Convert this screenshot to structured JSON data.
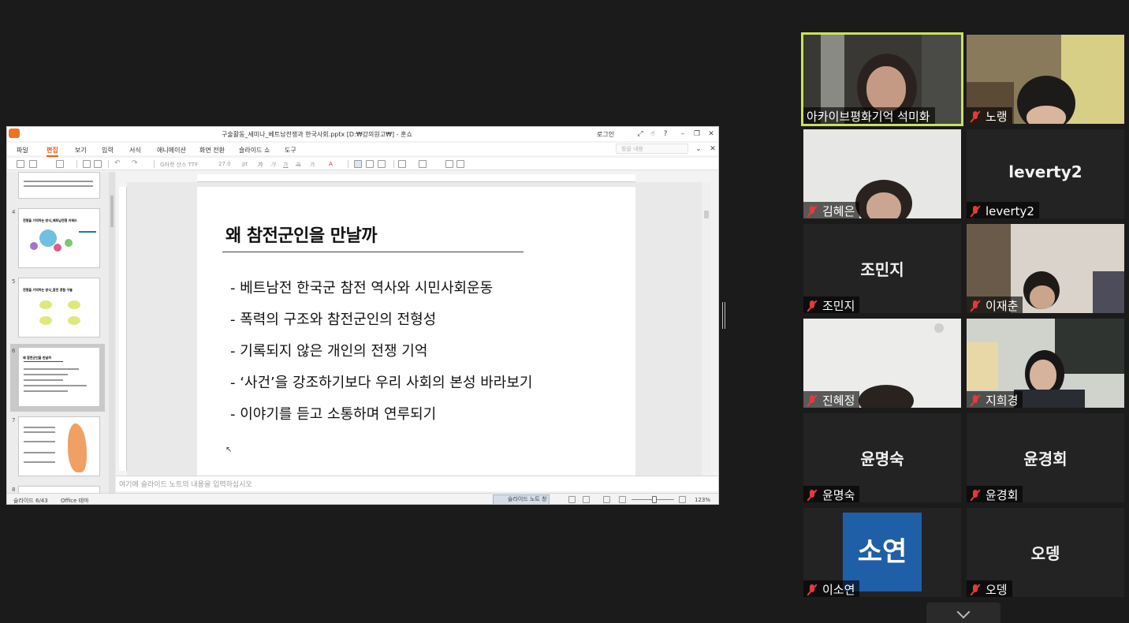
{
  "app": {
    "title": "구술활동_세미나_베트남전쟁과 한국사회.pptx [D:₩강의원고₩] - 훈쇼",
    "login_label": "로그인",
    "menus": [
      "파일",
      "편집",
      "보기",
      "입력",
      "서식",
      "애니메이션",
      "화면 전환",
      "슬라이드 쇼",
      "도구"
    ],
    "find_placeholder": "찾을 내용",
    "font_name": "G마켓 산스 TTF",
    "font_size": "27.0",
    "font_unit": "pt",
    "notes_placeholder": "여기에 슬라이드 노트의 내용을 입력하십시오",
    "status": {
      "slide_count": "슬라이드 6/43",
      "theme": "Office 테마",
      "notes_button": "슬라이드 노트 창",
      "zoom": "123%"
    }
  },
  "thumbnails": [
    {
      "num": "4",
      "title": "전쟁을 기억하는 방식_베트남전쟁 키워드"
    },
    {
      "num": "5",
      "title": "전쟁을 기억하는 방식_참전 경험 구술"
    },
    {
      "num": "6",
      "title": "왜 참전군인을 만날까"
    },
    {
      "num": "7",
      "title": ""
    },
    {
      "num": "8",
      "title": ""
    }
  ],
  "slide": {
    "title": "왜 참전군인을 만날까",
    "bullets": [
      "- 베트남전 한국군 참전 역사와 시민사회운동",
      "- 폭력의 구조와 참전군인의 전형성",
      "- 기록되지 않은 개인의 전쟁 기억",
      "- ‘사건’을 강조하기보다 우리 사회의 본성 바라보기",
      "- 이야기를 듣고 소통하며 연루되기"
    ]
  },
  "participants": [
    {
      "name": "아카이브평화기억 석미화",
      "muted": false,
      "video": true,
      "active": true
    },
    {
      "name": "노랭",
      "muted": true,
      "video": true
    },
    {
      "name": "김혜은",
      "muted": true,
      "video": true
    },
    {
      "name": "leverty2",
      "display": "leverty2",
      "muted": true,
      "video": false
    },
    {
      "name": "조민지",
      "display": "조민지",
      "muted": true,
      "video": false
    },
    {
      "name": "이재춘",
      "muted": true,
      "video": true
    },
    {
      "name": "진혜정",
      "muted": true,
      "video": true
    },
    {
      "name": "지희경",
      "muted": true,
      "video": true
    },
    {
      "name": "윤명숙",
      "display": "윤명숙",
      "muted": true,
      "video": false
    },
    {
      "name": "윤경회",
      "display": "윤경회",
      "muted": true,
      "video": false
    },
    {
      "name": "이소연",
      "avatar_text": "소연",
      "muted": true,
      "video": false
    },
    {
      "name": "오뎅",
      "display": "오뎅",
      "muted": true,
      "video": false
    }
  ],
  "colors": {
    "active_speaker_border": "#c8e35a",
    "muted_icon": "#e5393b",
    "accent_menu": "#e0631c",
    "avatar_bg": "#1f5fa8"
  }
}
